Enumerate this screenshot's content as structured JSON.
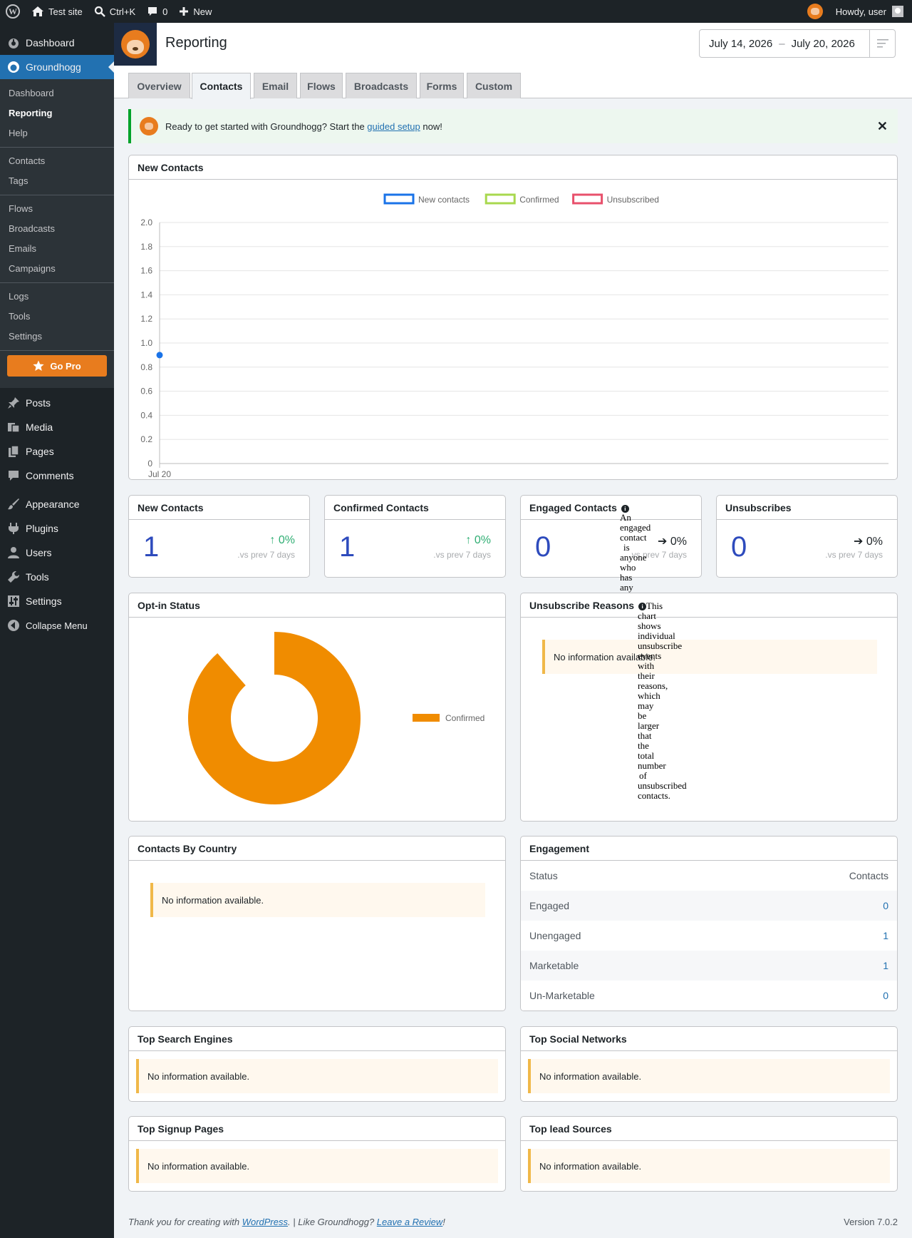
{
  "adminbar": {
    "site_name": "Test site",
    "search_shortcut": "Ctrl+K",
    "comments_count": "0",
    "new_label": "New",
    "greeting": "Howdy, user"
  },
  "sidebar": {
    "dashboard": "Dashboard",
    "groundhogg": "Groundhogg",
    "sub_groups": [
      [
        "Dashboard",
        "Reporting",
        "Help"
      ],
      [
        "Contacts",
        "Tags"
      ],
      [
        "Flows",
        "Broadcasts",
        "Emails",
        "Campaigns"
      ],
      [
        "Logs",
        "Tools",
        "Settings"
      ]
    ],
    "gopro": "Go Pro",
    "items": [
      "Posts",
      "Media",
      "Pages",
      "Comments",
      "Appearance",
      "Plugins",
      "Users",
      "Tools",
      "Settings",
      "Collapse Menu"
    ]
  },
  "header": {
    "title": "Reporting",
    "date_start": "July 14, 2026",
    "date_sep": "–",
    "date_end": "July 20, 2026"
  },
  "tabs": [
    "Overview",
    "Contacts",
    "Email",
    "Flows",
    "Broadcasts",
    "Forms",
    "Custom"
  ],
  "active_tab": "Contacts",
  "notice": {
    "text_before": "Ready to get started with Groundhogg? Start the ",
    "link": "guided setup",
    "text_after": " now!",
    "close": "✕"
  },
  "new_contacts_chart": {
    "title": "New Contacts",
    "chart_data": {
      "type": "line",
      "x": [
        "Jul 20"
      ],
      "series": [
        {
          "name": "New contacts",
          "values": [
            0.9
          ],
          "color": "#1a73e8"
        },
        {
          "name": "Confirmed",
          "values": [],
          "color": "#a8d84e"
        },
        {
          "name": "Unsubscribed",
          "values": [],
          "color": "#e8506c"
        }
      ],
      "ylim": [
        0,
        2.0
      ],
      "yticks": [
        "2.0",
        "1.8",
        "1.6",
        "1.4",
        "1.2",
        "1.0",
        "0.8",
        "0.6",
        "0.4",
        "0.2",
        "0"
      ],
      "legend": "top-center",
      "grid": true
    }
  },
  "stats": [
    {
      "title": "New Contacts",
      "value": "1",
      "pct": "0%",
      "dir": "↑",
      "vs": ".vs prev 7 days"
    },
    {
      "title": "Confirmed Contacts",
      "value": "1",
      "pct": "0%",
      "dir": "↑",
      "vs": ".vs prev 7 days"
    },
    {
      "title": "Engaged Contacts",
      "value": "0",
      "pct": "0%",
      "dir": "➔",
      "vs": ".vs prev 7 days",
      "tooltip": [
        "An",
        "engaged",
        "contact",
        "is",
        "anyone",
        "who",
        "has",
        "any"
      ]
    },
    {
      "title": "Unsubscribes",
      "value": "0",
      "pct": "0%",
      "dir": "➔",
      "vs": ".vs prev 7 days"
    }
  ],
  "optin": {
    "title": "Opt-in Status",
    "chart_data": {
      "type": "pie",
      "labels": [
        "Confirmed"
      ],
      "values": [
        1
      ],
      "colors": [
        "#f08c00"
      ],
      "legend": "right"
    }
  },
  "unsub": {
    "title": "Unsubscribe Reasons",
    "noinfo": "No information available.",
    "tooltip": [
      "This",
      "chart",
      "shows",
      "individual",
      "unsubscribe",
      "events",
      "with",
      "their",
      "reasons,",
      "which",
      "may",
      "be",
      "larger",
      "that",
      "the",
      "total",
      "number",
      "of",
      "unsubscribed",
      "contacts."
    ]
  },
  "country": {
    "title": "Contacts By Country",
    "noinfo": "No information available."
  },
  "engagement": {
    "title": "Engagement",
    "head_status": "Status",
    "head_contacts": "Contacts",
    "rows": [
      {
        "status": "Engaged",
        "count": "0"
      },
      {
        "status": "Unengaged",
        "count": "1"
      },
      {
        "status": "Marketable",
        "count": "1"
      },
      {
        "status": "Un-Marketable",
        "count": "0"
      }
    ]
  },
  "bottom_boxes": [
    {
      "title": "Top Search Engines",
      "noinfo": "No information available."
    },
    {
      "title": "Top Social Networks",
      "noinfo": "No information available."
    },
    {
      "title": "Top Signup Pages",
      "noinfo": "No information available."
    },
    {
      "title": "Top lead Sources",
      "noinfo": "No information available."
    }
  ],
  "footer": {
    "text1": "Thank you for creating with ",
    "wp_link": "WordPress",
    "text2": ". | Like Groundhogg? ",
    "review_link": "Leave a Review",
    "text3": "!",
    "version": "Version 7.0.2"
  }
}
